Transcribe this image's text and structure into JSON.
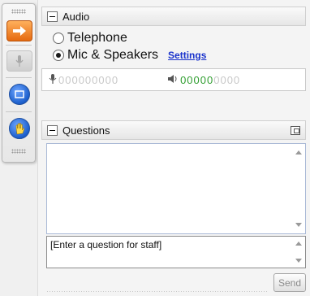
{
  "toolbar": {
    "buttons": [
      {
        "icon": "arrow-right-icon",
        "active": true
      },
      {
        "icon": "microphone-icon",
        "active": false
      },
      {
        "icon": "screen-icon",
        "active": false
      },
      {
        "icon": "raise-hand-icon",
        "active": false
      }
    ],
    "accent_color": "#e56a10"
  },
  "audio": {
    "title": "Audio",
    "options": [
      {
        "label": "Telephone",
        "selected": false
      },
      {
        "label": "Mic & Speakers",
        "selected": true
      }
    ],
    "settings_link": "Settings",
    "mic_level": "000000000",
    "speaker_lit": "00000",
    "speaker_unlit": "0000"
  },
  "questions": {
    "title": "Questions",
    "input_placeholder": "[Enter a question for staff]",
    "send_label": "Send"
  }
}
